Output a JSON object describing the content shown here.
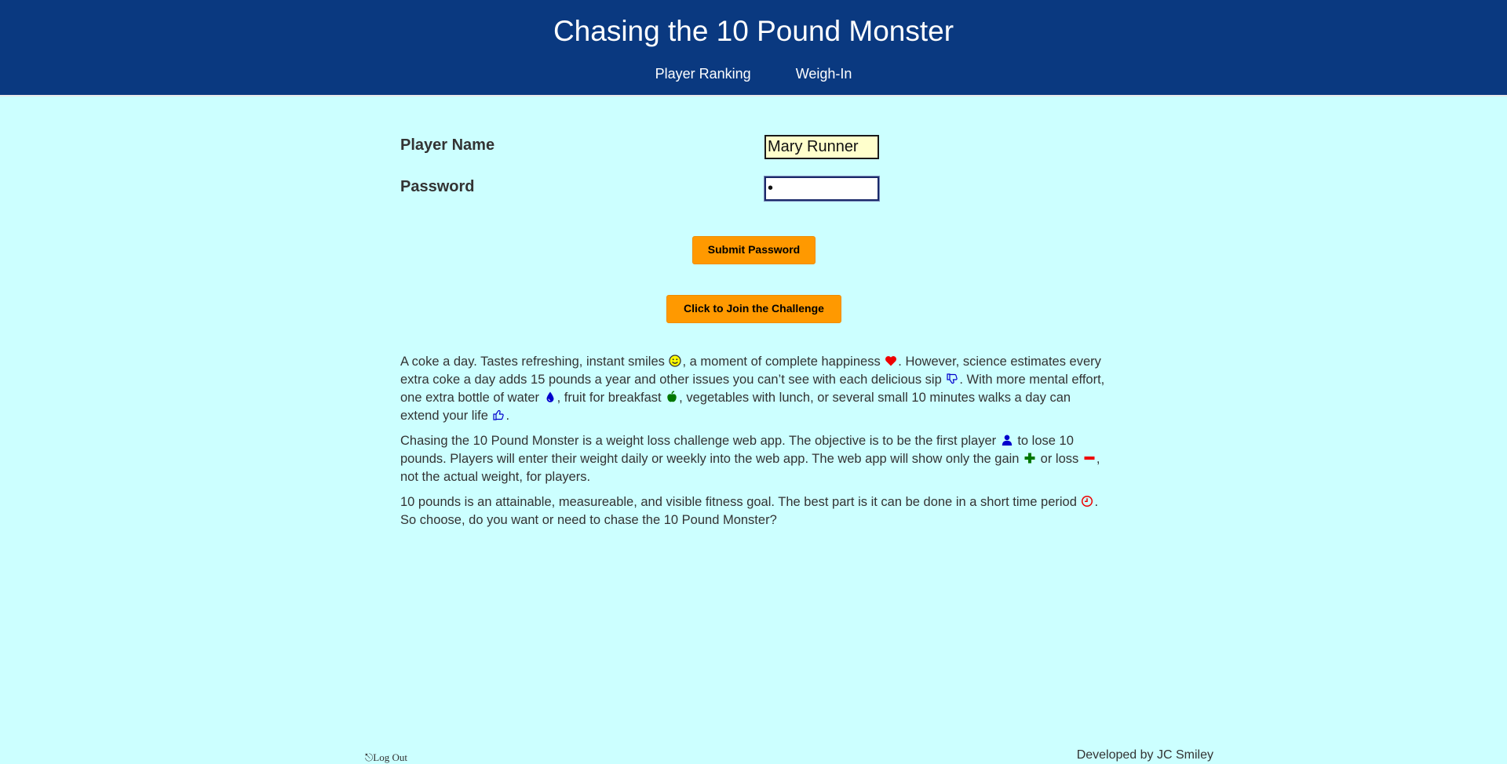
{
  "header": {
    "title": "Chasing the 10 Pound Monster",
    "nav": [
      "Player Ranking",
      "Weigh-In"
    ]
  },
  "form": {
    "name_label": "Player Name",
    "name_value": "Mary Runner",
    "password_label": "Password",
    "password_value": "•",
    "submit_label": "Submit Password",
    "join_label": "Click to Join the Challenge"
  },
  "paragraphs": {
    "p1": {
      "s1": "A coke a day. Tastes refreshing, instant smiles ",
      "s2": ", a moment of complete happiness ",
      "s3": ". However, science estimates every extra coke a day adds 15 pounds a year and other issues you can’t see with each delicious sip ",
      "s4": ". With more mental effort, one extra bottle of water ",
      "s5": ", fruit for breakfast ",
      "s6": ", vegetables with lunch, or several small 10 minutes walks a day can extend your life ",
      "s7": "."
    },
    "p2": {
      "s1": "Chasing the 10 Pound Monster is a weight loss challenge web app. The objective is to be the first player ",
      "s2": " to lose 10 pounds. Players will enter their weight daily or weekly into the web app. The web app will show only the gain ",
      "s3": " or loss ",
      "s4": ", not the actual weight, for players."
    },
    "p3": {
      "s1": "10 pounds is an attainable, measureable, and visible fitness goal. The best part is it can be done in a short time period ",
      "s2": ". So choose, do you want or need to chase the 10 Pound Monster?"
    }
  },
  "icons": {
    "smile": "smile-icon",
    "heart": "heart-icon",
    "thumbs_down": "thumbs-down-icon",
    "water": "water-drop-icon",
    "apple": "apple-icon",
    "thumbs_up": "thumbs-up-icon",
    "user": "user-icon",
    "plus": "plus-icon",
    "minus": "minus-icon",
    "clock": "clock-icon"
  },
  "footer": {
    "logout": "Log Out",
    "credit": "Developed by JC Smiley"
  },
  "colors": {
    "header_bg": "#0a3980",
    "page_bg": "#ccffff",
    "button_bg": "#ff9900",
    "name_input_bg": "#ffffcc"
  }
}
